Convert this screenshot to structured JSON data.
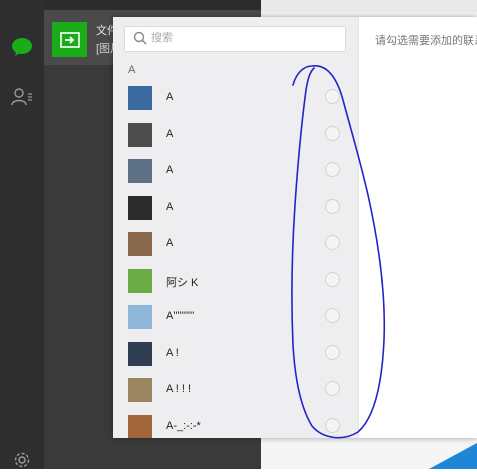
{
  "chat": {
    "title": "文件",
    "subtitle": "[图片"
  },
  "dialog": {
    "search_placeholder": "搜索",
    "section_letter": "A",
    "hint": "请勾选需要添加的联系人",
    "contacts": [
      {
        "name": "A",
        "avatar_color": "#3b6aa0"
      },
      {
        "name": "A",
        "avatar_color": "#4d4d4d"
      },
      {
        "name": "A",
        "avatar_color": "#5f7184"
      },
      {
        "name": "A",
        "avatar_color": "#2b2b2b"
      },
      {
        "name": "A",
        "avatar_color": "#8a6a4e"
      },
      {
        "name": "阿シ K",
        "avatar_color": "#6cab45"
      },
      {
        "name": "A''''''''''",
        "avatar_color": "#8db6d8"
      },
      {
        "name": "A !",
        "avatar_color": "#2f3c52"
      },
      {
        "name": "A ! ! !",
        "avatar_color": "#9a8660"
      },
      {
        "name": "A-_:-:-*",
        "avatar_color": "#a0653a"
      }
    ]
  },
  "colors": {
    "accent_green": "#1aad19",
    "annotation_blue": "#2323c8"
  }
}
